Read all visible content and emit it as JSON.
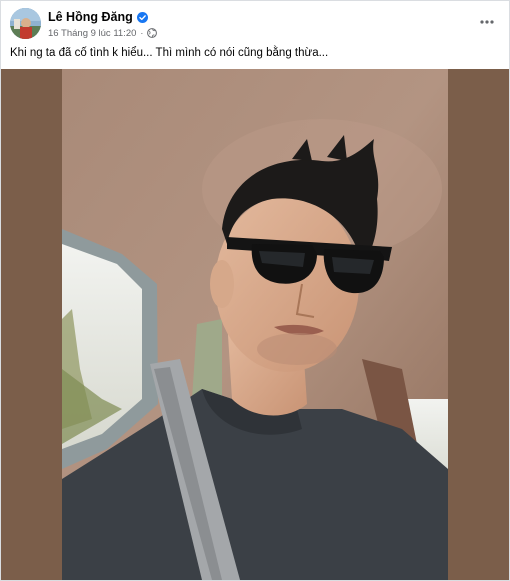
{
  "post": {
    "author": "Lê Hồng Đăng",
    "timestamp": "16 Tháng 9 lúc 11:20",
    "separator": "·",
    "caption": "Khi ng ta đã cố tình k hiểu... Thì mình có nói cũng bằng thừa...",
    "privacy_icon": "globe-icon",
    "verified_icon": "verified-badge-icon",
    "more_icon": "more-options-icon"
  },
  "colors": {
    "accent": "#1877f2",
    "photo_backdrop": "#7b5e4a",
    "secondary_text": "#65676b"
  }
}
